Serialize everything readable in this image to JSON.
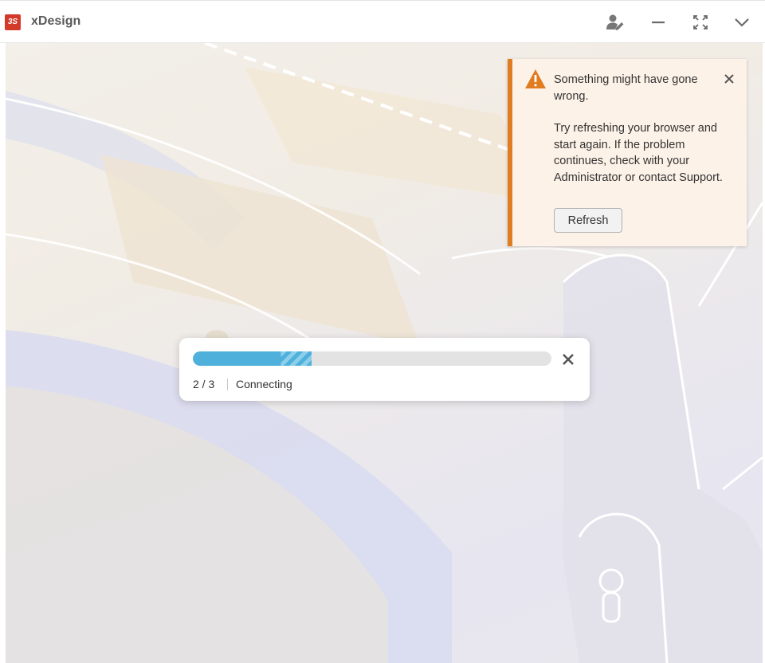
{
  "app": {
    "title": "xDesign",
    "logo_text": "3S"
  },
  "titlebar": {
    "icons": [
      "share-user-icon",
      "minimize-icon",
      "fullscreen-icon",
      "chevron-down-icon"
    ]
  },
  "alert": {
    "title": "Something might have gone wrong.",
    "body": "Try refreshing your browser and start again. If the problem continues, check with your Administrator or contact Support.",
    "refresh_label": "Refresh",
    "accent_color": "#e07c22"
  },
  "progress": {
    "step": "2 / 3",
    "status": "Connecting",
    "fraction": 0.33,
    "color": "#4fb0db"
  }
}
